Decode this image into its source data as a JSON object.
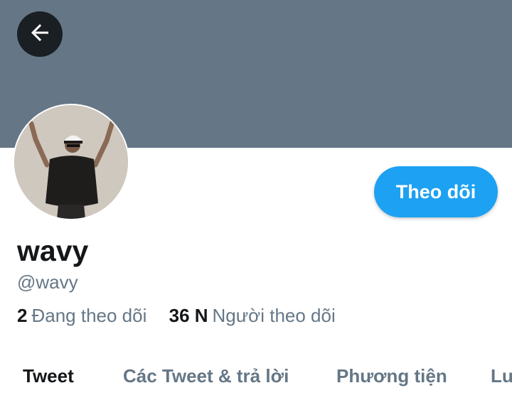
{
  "header": {
    "back_icon": "arrow-left-icon",
    "banner_color": "#657786"
  },
  "profile": {
    "display_name": "wavy",
    "handle": "@wavy",
    "avatar": "profile-photo",
    "follow_label": "Theo dõi",
    "accent_color": "#1da1f2"
  },
  "stats": {
    "following_count": "2",
    "following_label": "Đang theo dõi",
    "followers_count": "36 N",
    "followers_label": "Người theo dõi"
  },
  "tabs": [
    {
      "label": "Tweet",
      "active": true
    },
    {
      "label": "Các Tweet & trả lời",
      "active": false
    },
    {
      "label": "Phương tiện",
      "active": false
    },
    {
      "label": "Lượt thích",
      "active": false
    }
  ]
}
